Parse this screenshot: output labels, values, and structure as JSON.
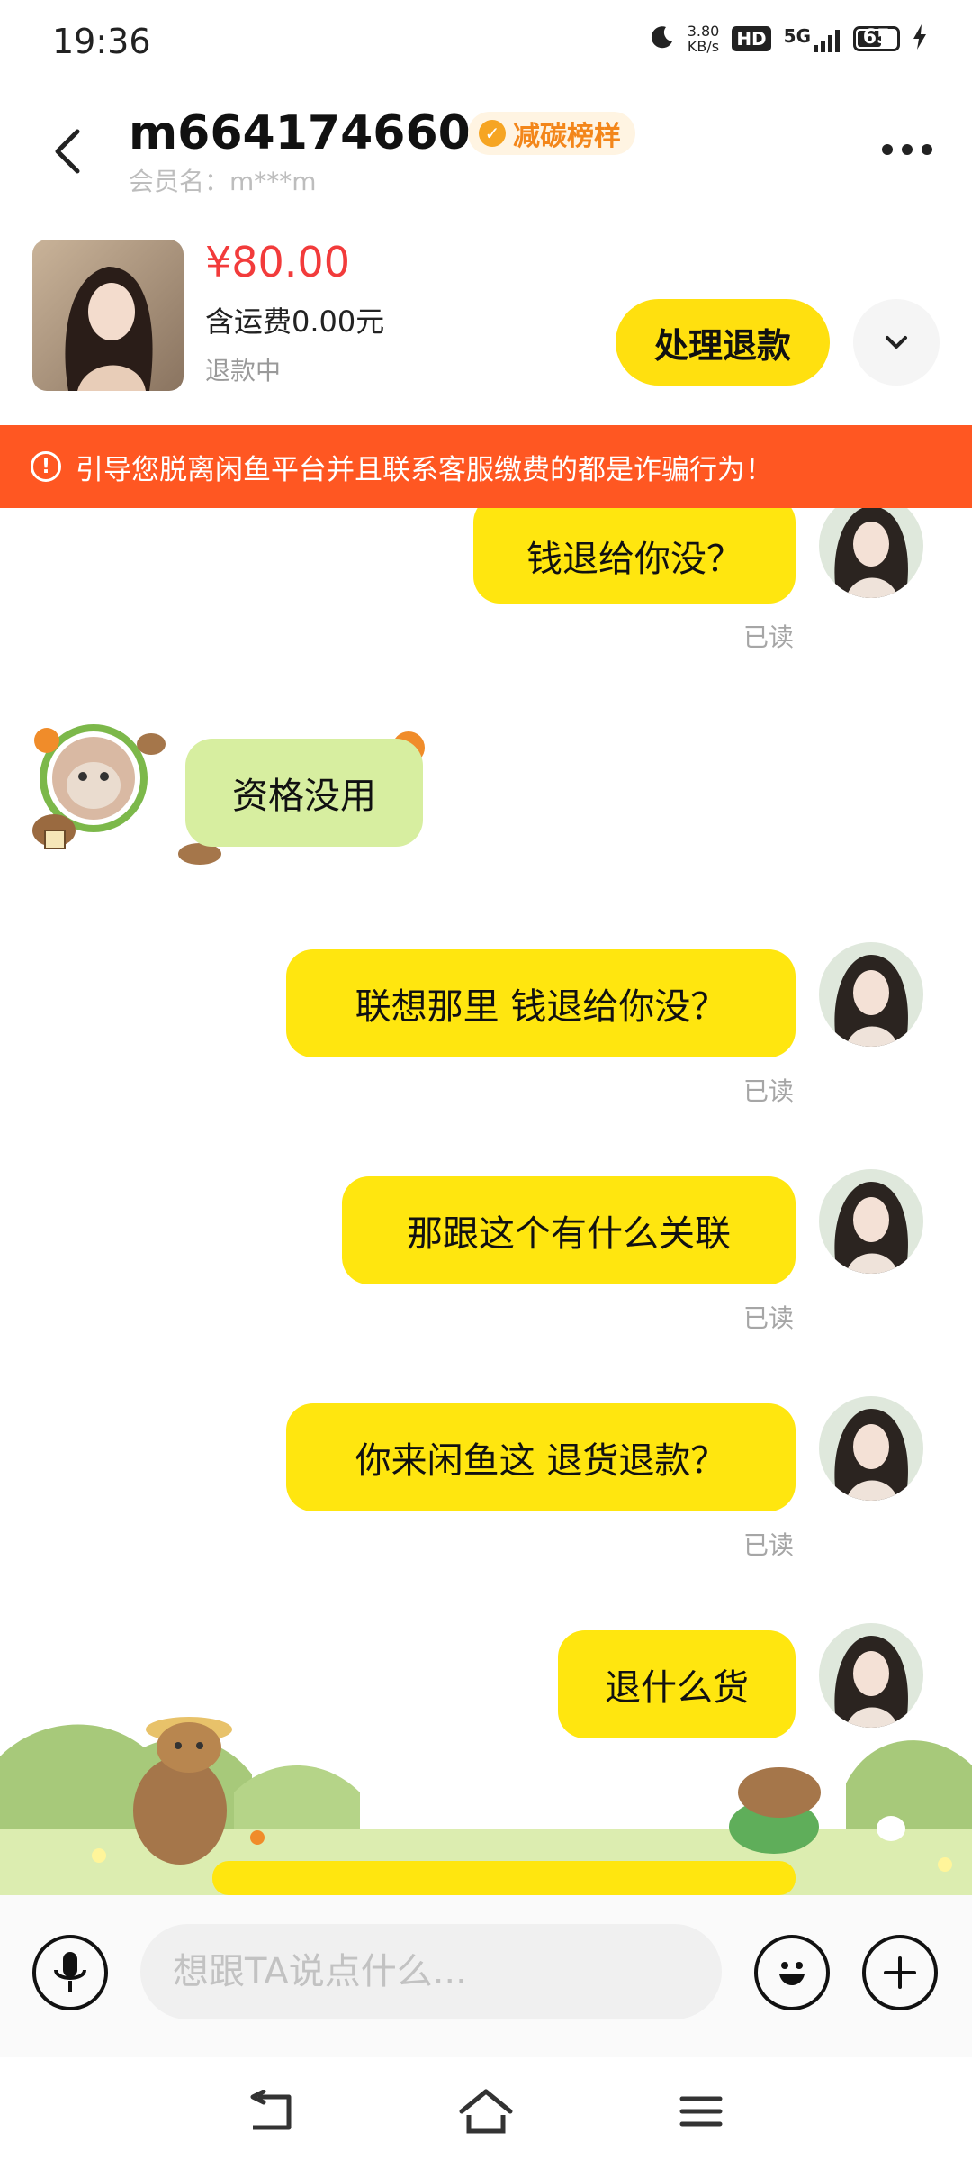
{
  "status_bar": {
    "time": "19:36",
    "speed_value": "3.80",
    "speed_unit": "KB/s",
    "hd": "HD",
    "network": "5G",
    "battery": "65",
    "battery_level": 0.65
  },
  "header": {
    "title": "m664174660m",
    "badge": "减碳榜样",
    "subtitle": "会员名：m***m"
  },
  "product": {
    "price": "¥80.00",
    "shipping": "含运费0.00元",
    "status": "退款中",
    "refund_button": "处理退款"
  },
  "warning": {
    "text": "引导您脱离闲鱼平台并且联系客服缴费的都是诈骗行为！"
  },
  "messages": [
    {
      "side": "right",
      "text": "钱退给你没？",
      "read": "已读"
    },
    {
      "side": "left",
      "text": "资格没用"
    },
    {
      "side": "right",
      "text": "联想那里 钱退给你没？",
      "read": "已读"
    },
    {
      "side": "right",
      "text": "那跟这个有什么关联",
      "read": "已读"
    },
    {
      "side": "right",
      "text": "你来闲鱼这 退货退款？",
      "read": "已读"
    },
    {
      "side": "right",
      "text": "退什么货"
    }
  ],
  "input": {
    "placeholder": "想跟TA说点什么..."
  },
  "icons": {
    "back": "chevron-left-icon",
    "more": "more-dots-icon",
    "voice": "microphone-icon",
    "emoji": "emoji-icon",
    "add": "plus-icon"
  },
  "colors": {
    "accent_yellow": "#ffe60f",
    "price_red": "#f23b3b",
    "warning_orange": "#ff5722",
    "peer_bubble_green": "#d7eea0"
  }
}
